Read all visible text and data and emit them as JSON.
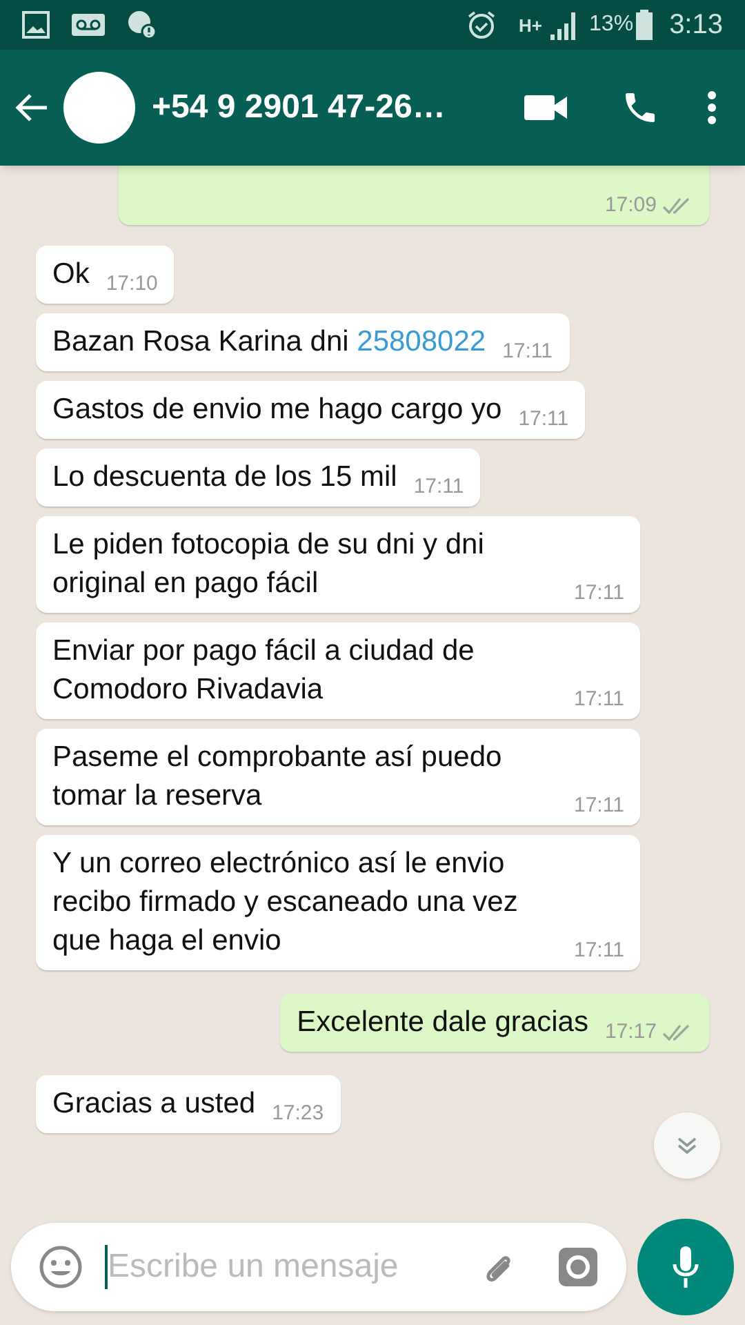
{
  "status_bar": {
    "network": "H+",
    "battery": "13%",
    "time": "3:13"
  },
  "header": {
    "title": "+54 9 2901 47-26…"
  },
  "messages": [
    {
      "kind": "out",
      "time": "17:09"
    },
    {
      "kind": "in",
      "text": "Ok",
      "time": "17:10"
    },
    {
      "kind": "in",
      "text": "Bazan Rosa Karina  dni ",
      "link": "25808022",
      "time": "17:11"
    },
    {
      "kind": "in",
      "text": "Gastos de envio me hago cargo yo",
      "time": "17:11"
    },
    {
      "kind": "in",
      "text": "Lo descuenta de los 15 mil",
      "time": "17:11"
    },
    {
      "kind": "in",
      "text": "Le piden fotocopia de su dni y dni original en pago fácil",
      "time": "17:11"
    },
    {
      "kind": "in",
      "text": "Enviar por pago fácil a ciudad de Comodoro Rivadavia",
      "time": "17:11"
    },
    {
      "kind": "in",
      "text": "Paseme el comprobante así puedo tomar la reserva",
      "time": "17:11"
    },
    {
      "kind": "in",
      "text": "Y un correo electrónico así le envio recibo firmado y escaneado una vez que haga el envio",
      "time": "17:11"
    },
    {
      "kind": "out",
      "text": "Excelente dale gracias",
      "time": "17:17"
    },
    {
      "kind": "in",
      "text": "Gracias a usted",
      "time": "17:23"
    }
  ],
  "composer": {
    "placeholder": "Escribe un mensaje"
  }
}
